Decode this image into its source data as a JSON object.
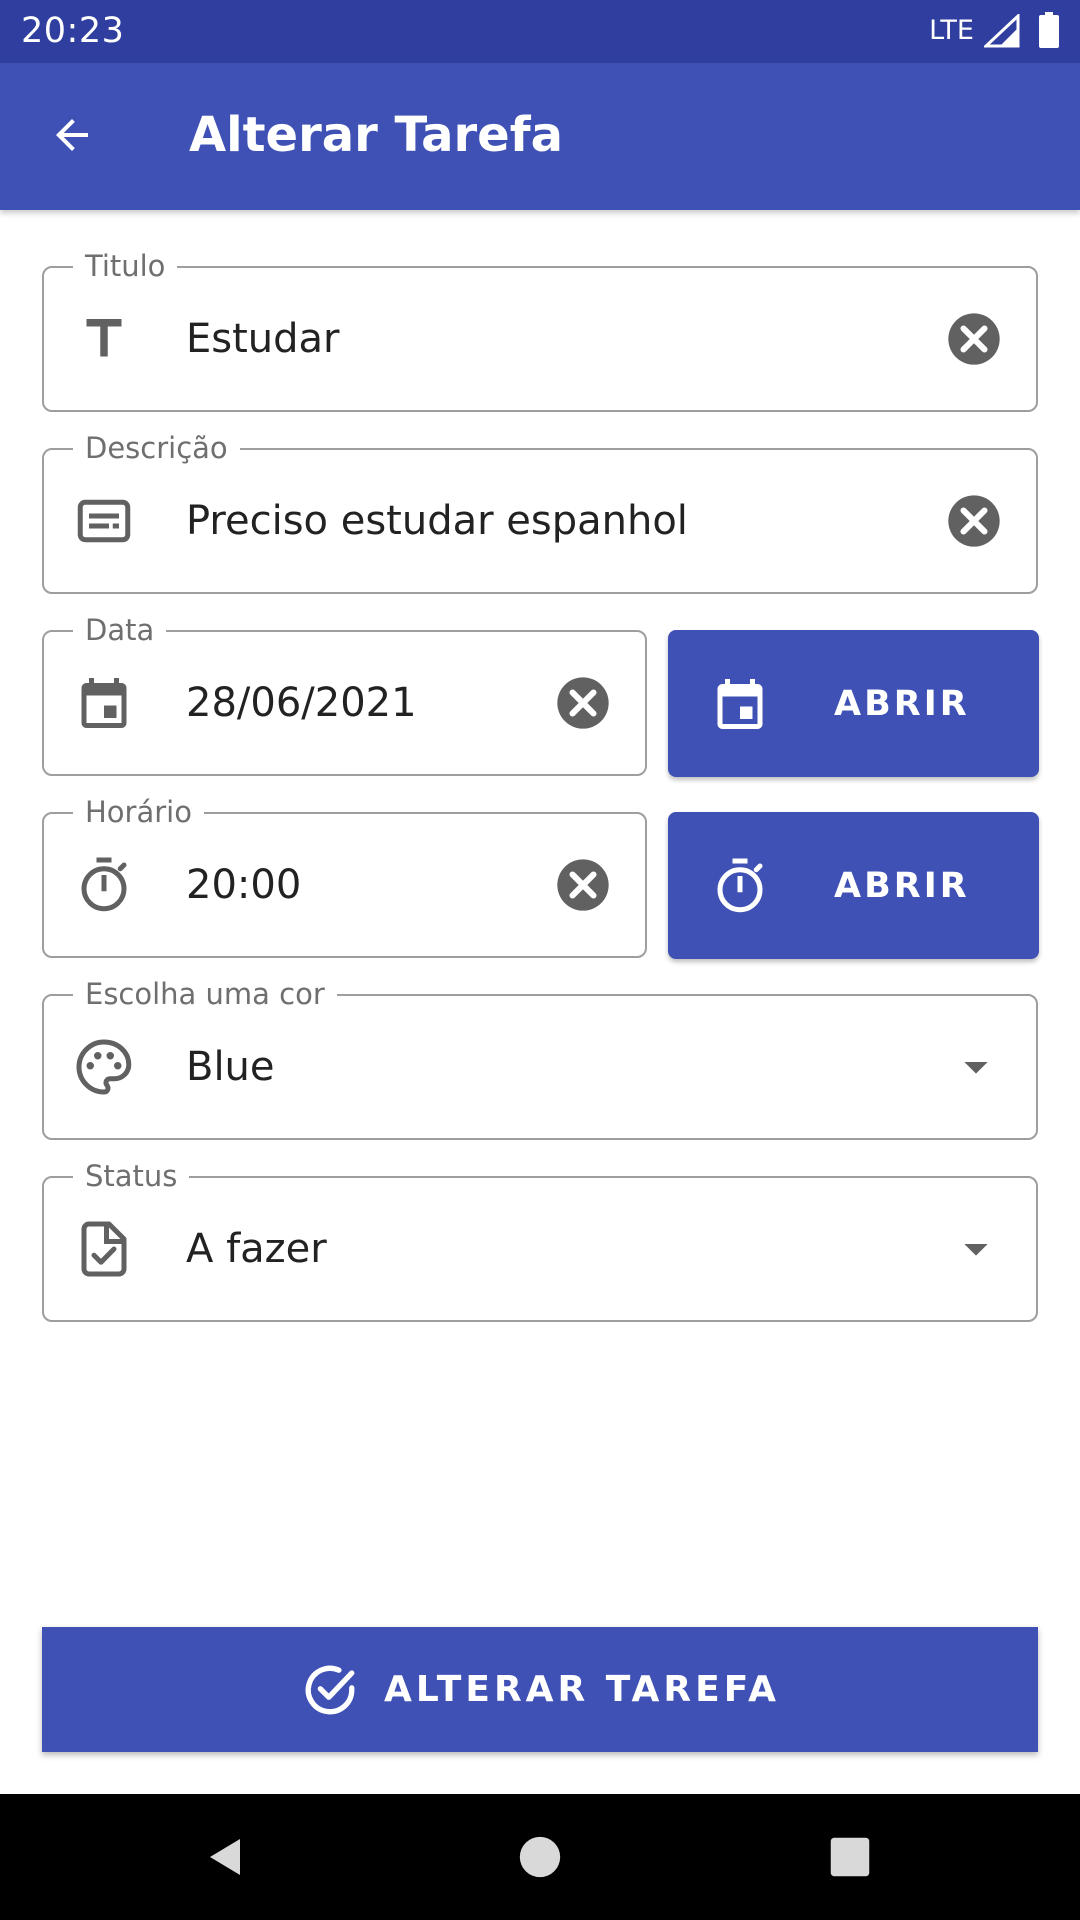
{
  "status_bar": {
    "time": "20:23",
    "network": "LTE"
  },
  "app_bar": {
    "title": "Alterar Tarefa",
    "back_icon": "arrow-back-icon"
  },
  "fields": {
    "titulo": {
      "label": "Titulo",
      "value": "Estudar",
      "icon": "text-icon"
    },
    "descricao": {
      "label": "Descrição",
      "value": "Preciso estudar espanhol",
      "icon": "subject-icon"
    },
    "data": {
      "label": "Data",
      "value": "28/06/2021",
      "icon": "calendar-icon"
    },
    "horario": {
      "label": "Horário",
      "value": "20:00",
      "icon": "timer-icon"
    },
    "cor": {
      "label": "Escolha uma cor",
      "value": "Blue",
      "icon": "palette-icon"
    },
    "status": {
      "label": "Status",
      "value": "A fazer",
      "icon": "task-file-icon"
    }
  },
  "buttons": {
    "abrir_data": {
      "label": "ABRIR",
      "icon": "calendar-icon"
    },
    "abrir_horario": {
      "label": "ABRIR",
      "icon": "timer-icon"
    },
    "alterar_tarefa": {
      "label": "ALTERAR TAREFA",
      "icon": "check-circle-icon"
    }
  },
  "colors": {
    "primary": "#3f51b5",
    "primary_dark": "#303f9f",
    "field_border": "#9e9e9e",
    "icon_gray": "#616161"
  }
}
